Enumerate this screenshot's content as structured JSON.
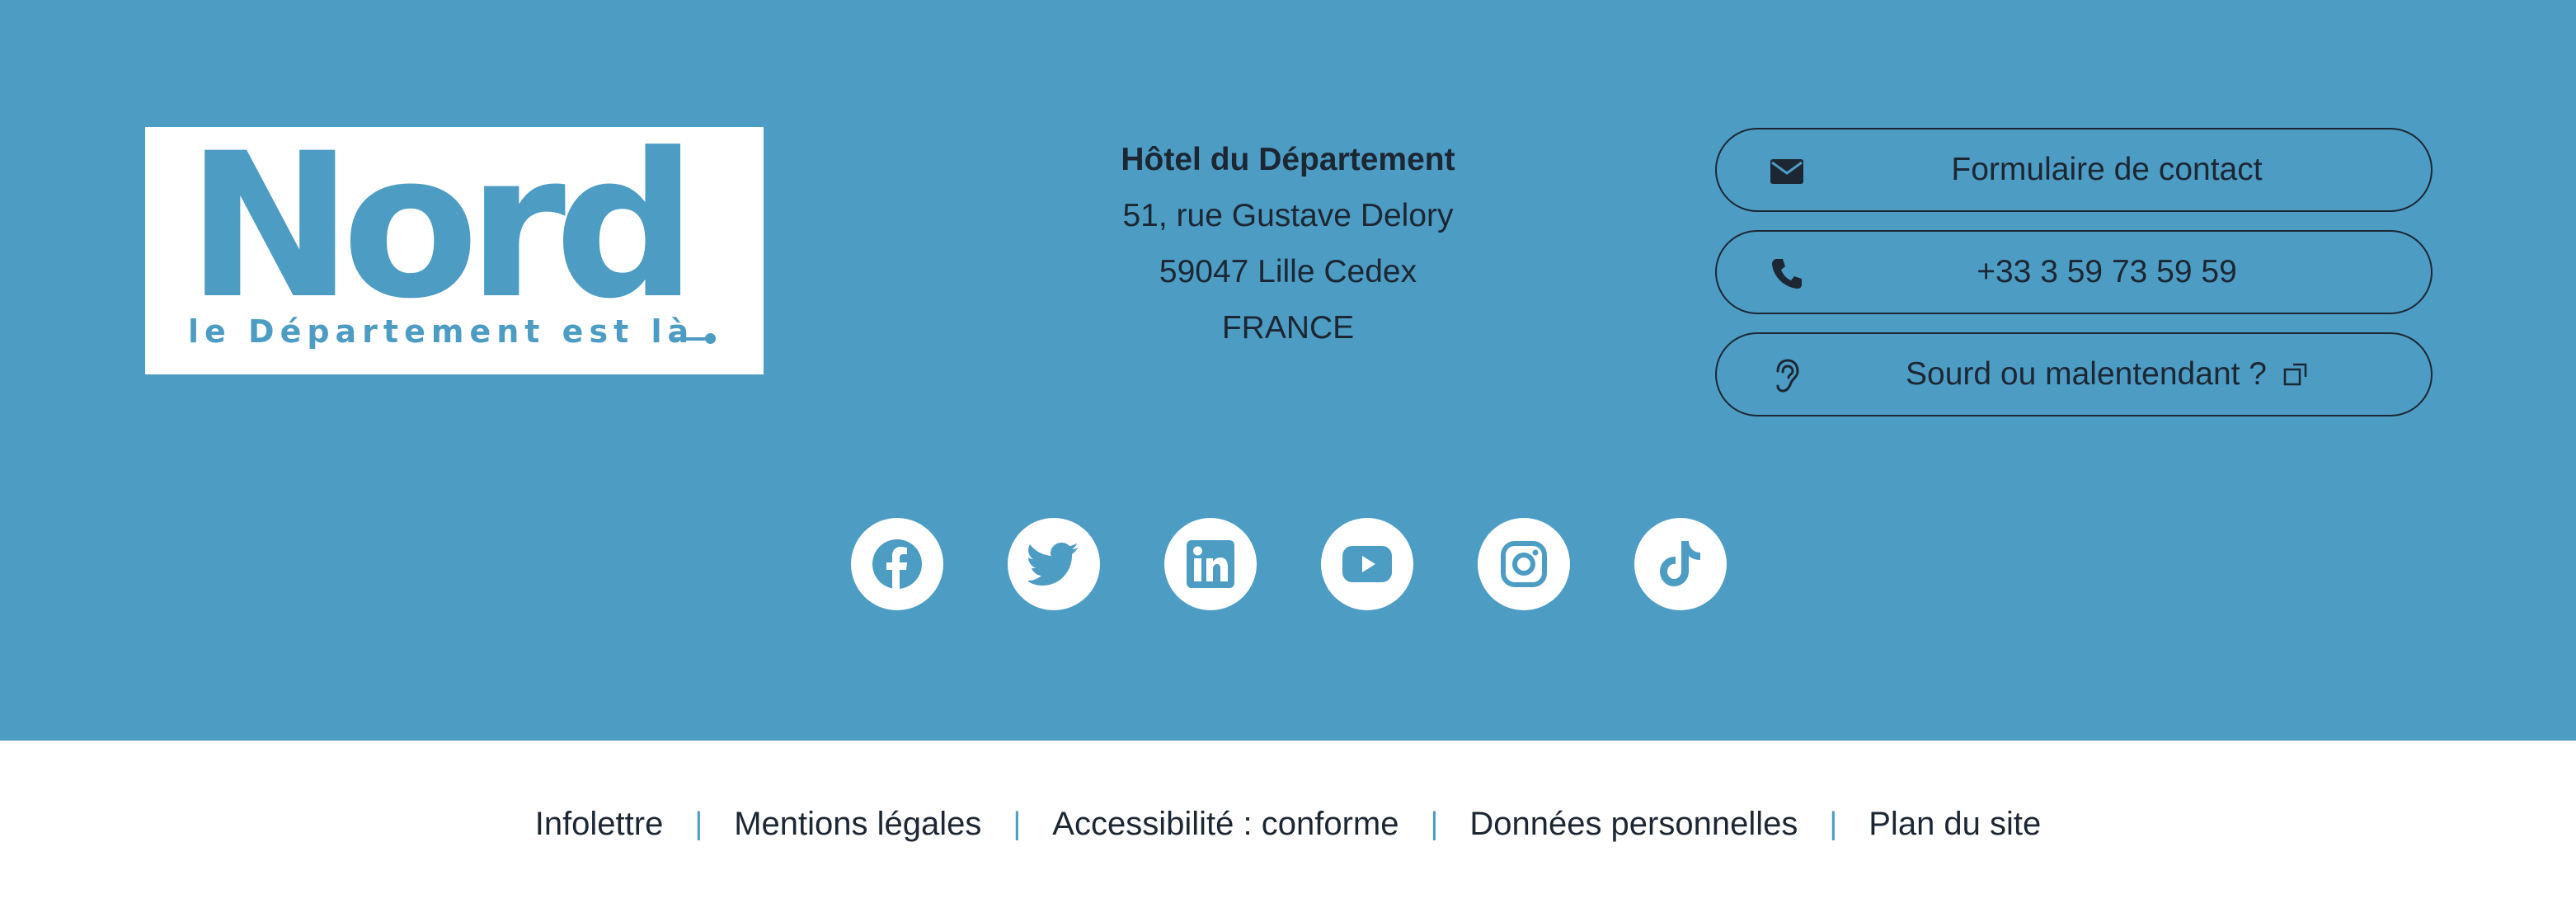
{
  "colors": {
    "accent": "#4d9cc4",
    "text": "#1c2733",
    "background": "#ffffff"
  },
  "logo": {
    "word": "Nord",
    "tagline": "le Département est là"
  },
  "address": {
    "name": "Hôtel du Département",
    "street": "51, rue Gustave Delory",
    "city": "59047 Lille Cedex",
    "country": "FRANCE"
  },
  "contact": {
    "form_label": "Formulaire de contact",
    "phone_label": "+33 3 59 73 59 59",
    "deaf_label": "Sourd ou malentendant ?"
  },
  "social": [
    "facebook-icon",
    "twitter-icon",
    "linkedin-icon",
    "youtube-icon",
    "instagram-icon",
    "tiktok-icon"
  ],
  "footer_links": {
    "newsletter": "Infolettre",
    "legal": "Mentions légales",
    "accessibility": "Accessibilité : conforme",
    "privacy": "Données personnelles",
    "sitemap": "Plan du site",
    "separator": "|"
  }
}
